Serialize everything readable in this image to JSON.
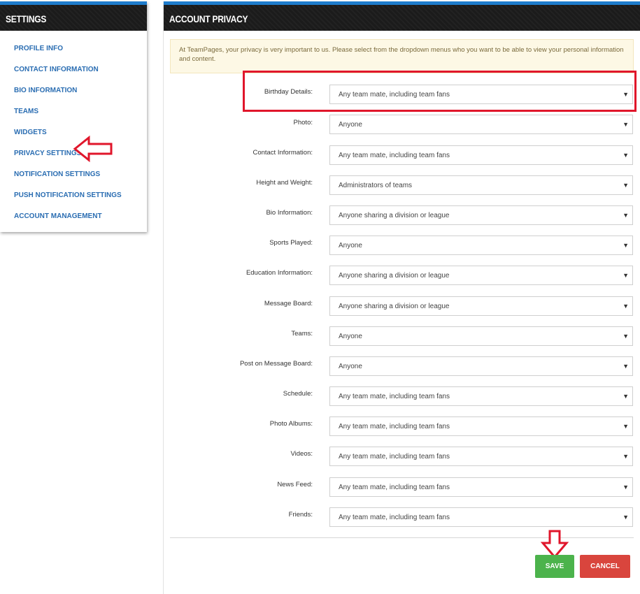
{
  "sidebar": {
    "title": "SETTINGS",
    "items": [
      {
        "label": "PROFILE INFO"
      },
      {
        "label": "CONTACT INFORMATION"
      },
      {
        "label": "BIO INFORMATION"
      },
      {
        "label": "TEAMS"
      },
      {
        "label": "WIDGETS"
      },
      {
        "label": "PRIVACY SETTINGS"
      },
      {
        "label": "NOTIFICATION SETTINGS"
      },
      {
        "label": "PUSH NOTIFICATION SETTINGS"
      },
      {
        "label": "ACCOUNT MANAGEMENT"
      }
    ]
  },
  "main": {
    "title": "ACCOUNT PRIVACY",
    "notice": "At TeamPages, your privacy is very important to us. Please select from the dropdown menus who you want to be able to view your personal information and content.",
    "rows": [
      {
        "label": "Birthday Details:",
        "value": "Any team mate, including team fans"
      },
      {
        "label": "Photo:",
        "value": "Anyone"
      },
      {
        "label": "Contact Information:",
        "value": "Any team mate, including team fans"
      },
      {
        "label": "Height and Weight:",
        "value": "Administrators of teams"
      },
      {
        "label": "Bio Information:",
        "value": "Anyone sharing a division or league"
      },
      {
        "label": "Sports Played:",
        "value": "Anyone"
      },
      {
        "label": "Education Information:",
        "value": "Anyone sharing a division or league"
      },
      {
        "label": "Message Board:",
        "value": "Anyone sharing a division or league"
      },
      {
        "label": "Teams:",
        "value": "Anyone"
      },
      {
        "label": "Post on Message Board:",
        "value": "Anyone"
      },
      {
        "label": "Schedule:",
        "value": "Any team mate, including team fans"
      },
      {
        "label": "Photo Albums:",
        "value": "Any team mate, including team fans"
      },
      {
        "label": "Videos:",
        "value": "Any team mate, including team fans"
      },
      {
        "label": "News Feed:",
        "value": "Any team mate, including team fans"
      },
      {
        "label": "Friends:",
        "value": "Any team mate, including team fans"
      }
    ],
    "caret": "▼",
    "save_label": "SAVE",
    "cancel_label": "CANCEL"
  },
  "colors": {
    "accent_blue": "#1e7ccc",
    "link_blue": "#2a6db2",
    "highlight_red": "#e0162b",
    "save_green": "#4cb34c",
    "cancel_red": "#d9453d"
  }
}
